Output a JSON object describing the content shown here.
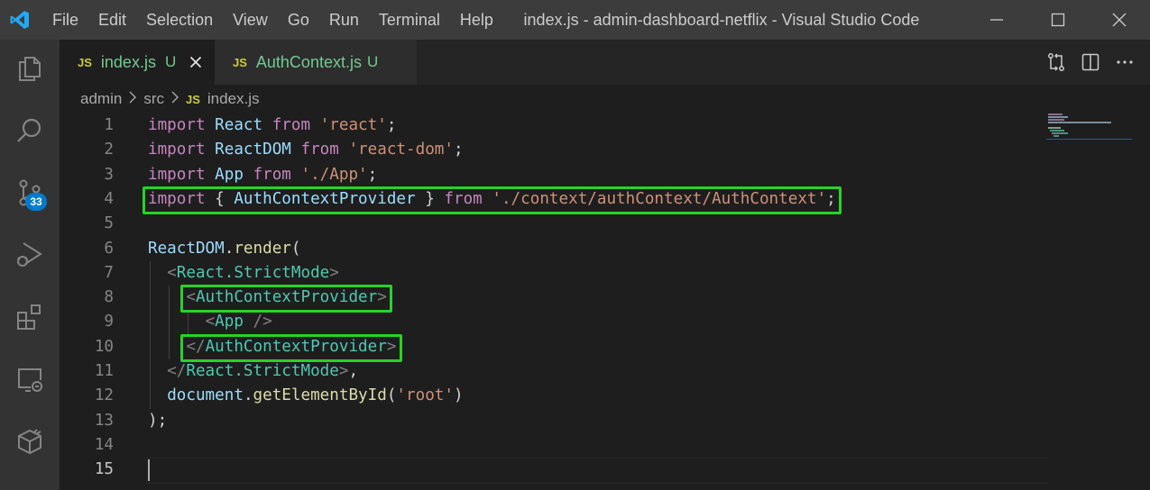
{
  "window": {
    "title": "index.js - admin-dashboard-netflix - Visual Studio Code"
  },
  "menu": [
    "File",
    "Edit",
    "Selection",
    "View",
    "Go",
    "Run",
    "Terminal",
    "Help"
  ],
  "activity_bar": {
    "items": [
      "explorer-icon",
      "search-icon",
      "source-control-icon",
      "run-debug-icon",
      "extensions-icon",
      "remote-explorer-icon",
      "docker-icon"
    ],
    "source_control_badge": "33"
  },
  "tabs": [
    {
      "icon_text": "JS",
      "label": "index.js",
      "status": "U",
      "active": true
    },
    {
      "icon_text": "JS",
      "label": "AuthContext.js",
      "status": "U",
      "active": false
    }
  ],
  "breadcrumb": {
    "items": [
      "admin",
      "src"
    ],
    "file_icon": "JS",
    "file": "index.js"
  },
  "editor": {
    "line_numbers": [
      "1",
      "2",
      "3",
      "4",
      "5",
      "6",
      "7",
      "8",
      "9",
      "10",
      "11",
      "12",
      "13",
      "14",
      "15"
    ],
    "current_line": "15",
    "highlight_color": "#27d327",
    "lines": [
      [
        [
          "kw",
          "import "
        ],
        [
          "var",
          "React "
        ],
        [
          "kw",
          "from "
        ],
        [
          "str",
          "'react'"
        ],
        [
          "punc",
          ";"
        ]
      ],
      [
        [
          "kw",
          "import "
        ],
        [
          "var",
          "ReactDOM "
        ],
        [
          "kw",
          "from "
        ],
        [
          "str",
          "'react-dom'"
        ],
        [
          "punc",
          ";"
        ]
      ],
      [
        [
          "kw",
          "import "
        ],
        [
          "var",
          "App "
        ],
        [
          "kw",
          "from "
        ],
        [
          "str",
          "'./App'"
        ],
        [
          "punc",
          ";"
        ]
      ],
      [
        [
          "kw",
          "import "
        ],
        [
          "punc",
          "{ "
        ],
        [
          "var",
          "AuthContextProvider "
        ],
        [
          "punc",
          "} "
        ],
        [
          "kw",
          "from "
        ],
        [
          "str",
          "'./context/authContext/AuthContext'"
        ],
        [
          "punc",
          ";"
        ]
      ],
      [],
      [
        [
          "var",
          "ReactDOM"
        ],
        [
          "punc",
          "."
        ],
        [
          "fn",
          "render"
        ],
        [
          "punc",
          "("
        ]
      ],
      [
        [
          "punc",
          "  "
        ],
        [
          "tag-b",
          "<"
        ],
        [
          "tag",
          "React.StrictMode"
        ],
        [
          "tag-b",
          ">"
        ]
      ],
      [
        [
          "punc",
          "    "
        ],
        [
          "tag-b",
          "<"
        ],
        [
          "tag",
          "AuthContextProvider"
        ],
        [
          "tag-b",
          ">"
        ]
      ],
      [
        [
          "punc",
          "      "
        ],
        [
          "tag-b",
          "<"
        ],
        [
          "tag",
          "App "
        ],
        [
          "tag-b",
          "/>"
        ]
      ],
      [
        [
          "punc",
          "    "
        ],
        [
          "tag-b",
          "</"
        ],
        [
          "tag",
          "AuthContextProvider"
        ],
        [
          "tag-b",
          ">"
        ]
      ],
      [
        [
          "punc",
          "  "
        ],
        [
          "tag-b",
          "</"
        ],
        [
          "tag",
          "React.StrictMode"
        ],
        [
          "tag-b",
          ">"
        ],
        [
          "punc",
          ","
        ]
      ],
      [
        [
          "punc",
          "  "
        ],
        [
          "var",
          "document"
        ],
        [
          "punc",
          "."
        ],
        [
          "fn",
          "getElementById"
        ],
        [
          "punc",
          "("
        ],
        [
          "str",
          "'root'"
        ],
        [
          "punc",
          ")"
        ]
      ],
      [
        [
          "punc",
          ");"
        ]
      ],
      [],
      []
    ]
  }
}
